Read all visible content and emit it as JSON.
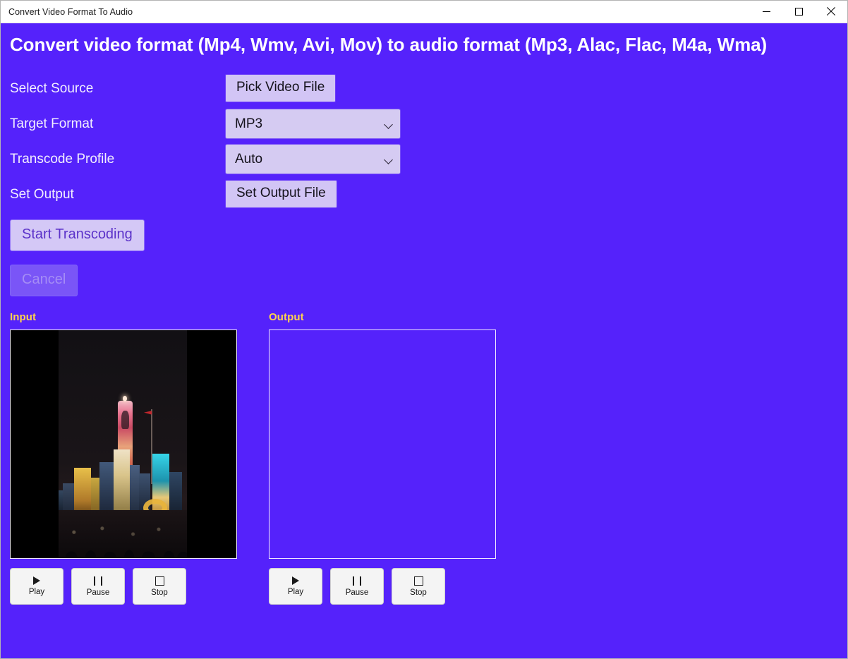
{
  "window": {
    "title": "Convert Video Format To Audio",
    "controls": {
      "minimize_label": "Minimize",
      "maximize_label": "Maximize",
      "close_label": "Close"
    }
  },
  "colors": {
    "app_background": "#5522fb",
    "heading_text": "#ffffff",
    "panel_title": "#ffd34d",
    "button_fill": "#d2c5f5",
    "combo_fill": "#d5cbf2",
    "start_text": "#5b32c9",
    "cancel_fill": "#7a55f7",
    "cancel_text": "#a58df5"
  },
  "heading": "Convert video format (Mp4, Wmv, Avi, Mov) to audio format (Mp3, Alac, Flac, M4a, Wma)",
  "form": {
    "rows": [
      {
        "label": "Select Source",
        "control": "Pick Video File"
      },
      {
        "label": "Target Format",
        "control": "MP3"
      },
      {
        "label": "Transcode Profile",
        "control": "Auto"
      },
      {
        "label": "Set Output",
        "control": "Set Output File"
      }
    ]
  },
  "actions": {
    "start_label": "Start Transcoding",
    "start_enabled": true,
    "cancel_label": "Cancel",
    "cancel_enabled": false
  },
  "previews": {
    "input": {
      "title": "Input",
      "has_media": true,
      "controls": [
        {
          "icon": "play-icon",
          "label": "Play"
        },
        {
          "icon": "pause-icon",
          "label": "Pause"
        },
        {
          "icon": "stop-icon",
          "label": "Stop"
        }
      ]
    },
    "output": {
      "title": "Output",
      "has_media": false,
      "controls": [
        {
          "icon": "play-icon",
          "label": "Play"
        },
        {
          "icon": "pause-icon",
          "label": "Pause"
        },
        {
          "icon": "stop-icon",
          "label": "Stop"
        }
      ]
    }
  }
}
